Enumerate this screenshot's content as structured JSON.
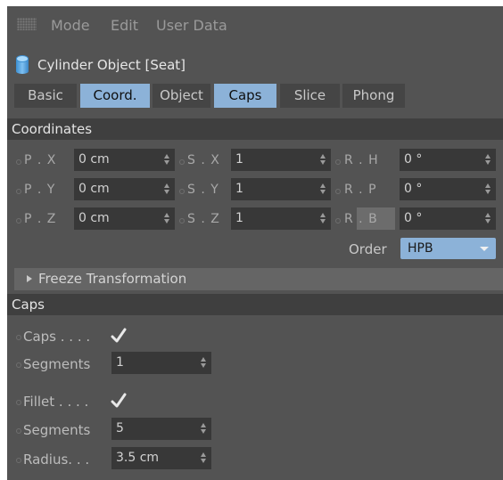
{
  "menu": {
    "items": [
      "Mode",
      "Edit",
      "User Data"
    ]
  },
  "object": {
    "title": "Cylinder Object [Seat]"
  },
  "tabs": [
    {
      "label": "Basic",
      "active": false
    },
    {
      "label": "Coord.",
      "active": true
    },
    {
      "label": "Object",
      "active": false
    },
    {
      "label": "Caps",
      "active": true
    },
    {
      "label": "Slice",
      "active": false
    },
    {
      "label": "Phong",
      "active": false
    }
  ],
  "coordinates": {
    "header": "Coordinates",
    "position": [
      {
        "label": "P . X",
        "value": "0 cm"
      },
      {
        "label": "P . Y",
        "value": "0 cm"
      },
      {
        "label": "P . Z",
        "value": "0 cm"
      }
    ],
    "scale": [
      {
        "label": "S . X",
        "value": "1"
      },
      {
        "label": "S . Y",
        "value": "1"
      },
      {
        "label": "S . Z",
        "value": "1"
      }
    ],
    "rotation": [
      {
        "label": "R . H",
        "value": "0 °"
      },
      {
        "label": "R . P",
        "value": "0 °"
      },
      {
        "label": "R . B",
        "value": "0 °"
      }
    ],
    "order_label": "Order",
    "order_value": "HPB",
    "freeze_label": "Freeze Transformation"
  },
  "caps": {
    "header": "Caps",
    "caps_label": "Caps . . . .",
    "caps_checked": true,
    "segments_label": "Segments",
    "segments_value": "1",
    "fillet_label": "Fillet . . . .",
    "fillet_checked": true,
    "fillet_segments_label": "Segments",
    "fillet_segments_value": "5",
    "radius_label": "Radius. . .",
    "radius_value": "3.5 cm"
  },
  "colors": {
    "panel_bg": "#535353",
    "section_bg": "#3f3f3f",
    "field_bg": "#383838",
    "active_tab": "#8cb2d8"
  }
}
